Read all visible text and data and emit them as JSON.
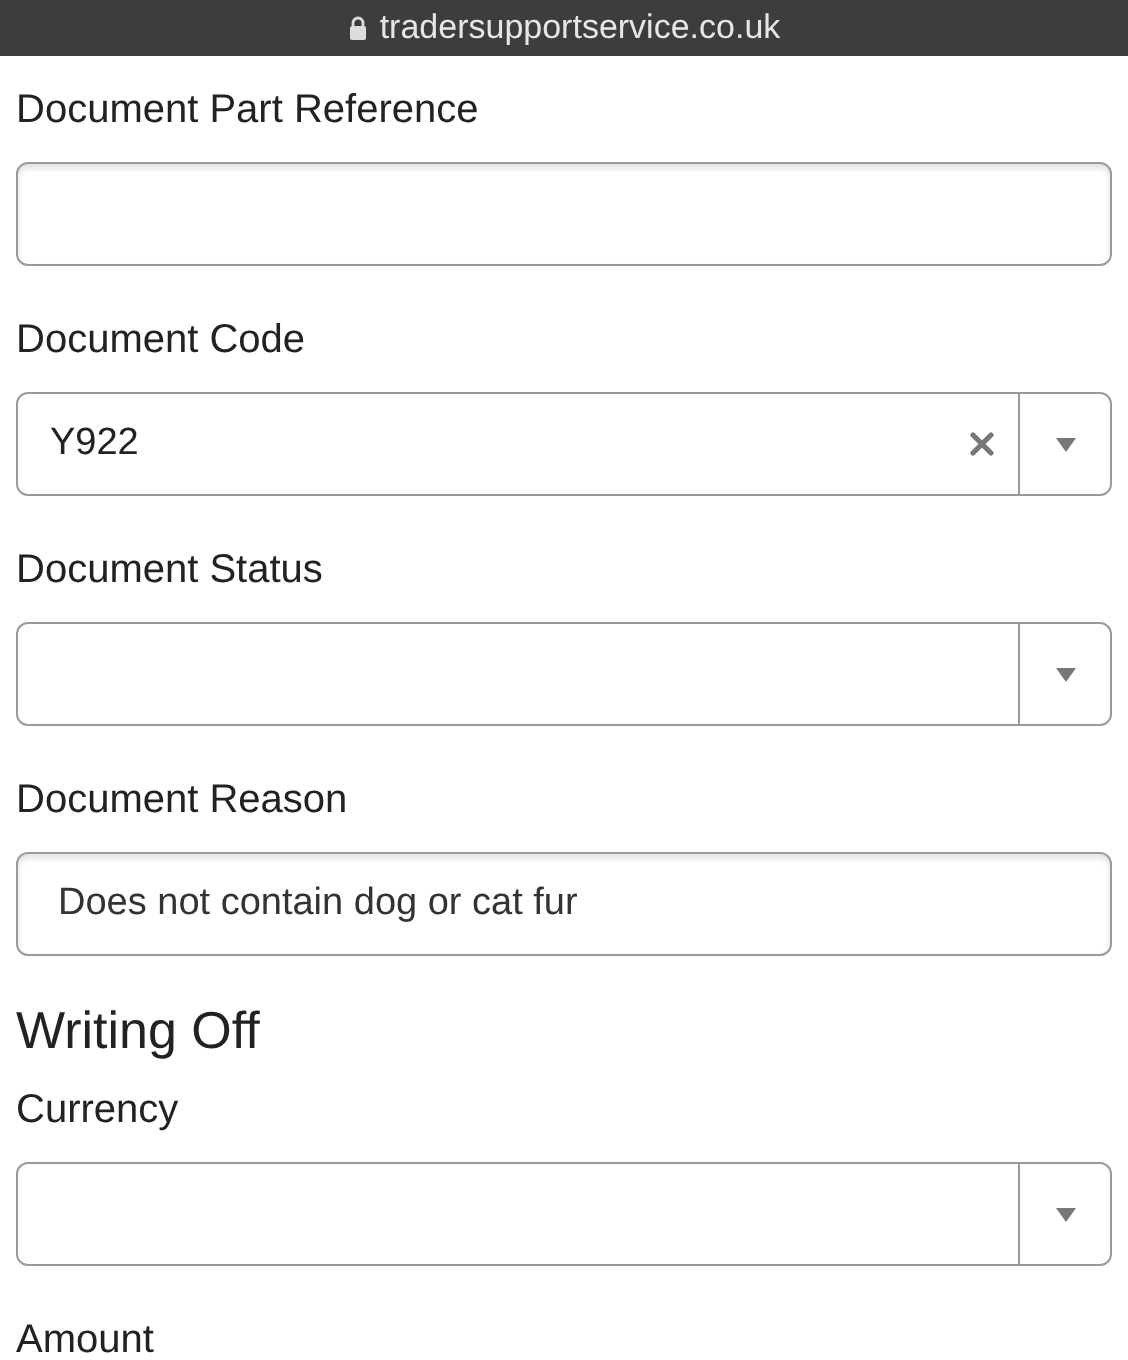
{
  "address_bar": {
    "url": "tradersupportservice.co.uk"
  },
  "form": [
    {
      "kind": "field",
      "label": "Document Part Reference",
      "dropdown": false
    },
    {
      "kind": "field",
      "label": "Document Code",
      "dropdown": true,
      "value": "Y922",
      "clearable": true
    },
    {
      "kind": "field",
      "label": "Document Status",
      "dropdown": true
    },
    {
      "kind": "field",
      "label": "Document Reason",
      "dropdown": false,
      "value": "Does not contain dog or cat fur"
    },
    {
      "kind": "heading",
      "label": "Writing Off"
    },
    {
      "kind": "field",
      "label": "Currency",
      "dropdown": true
    },
    {
      "kind": "label",
      "label": "Amount"
    }
  ]
}
